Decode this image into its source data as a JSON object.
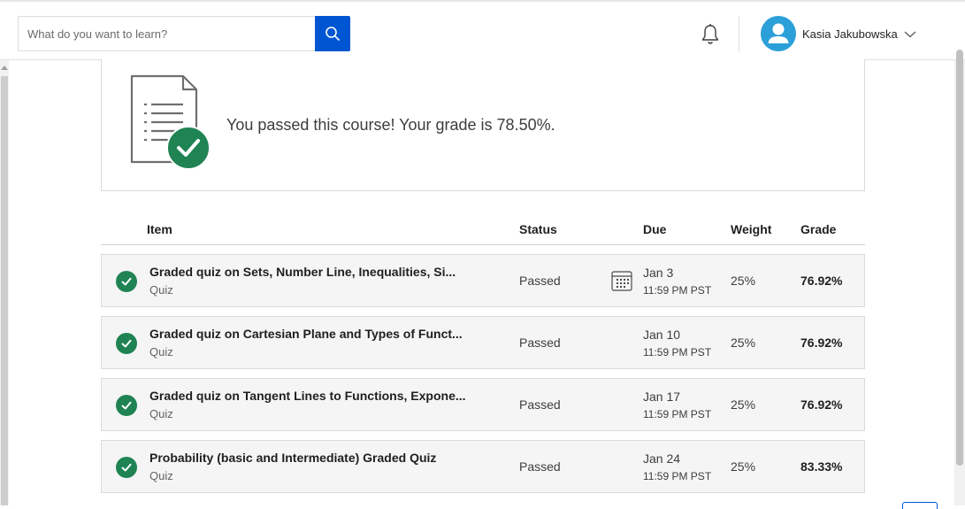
{
  "search": {
    "placeholder": "What do you want to learn?",
    "value": ""
  },
  "user": {
    "name": "Kasia Jakubowska"
  },
  "icons": {
    "search": "search-icon",
    "notifications": "bell-icon",
    "avatar": "person-icon",
    "menu": "chevron-down-icon",
    "passed": "checkmark-circle-icon",
    "due": "calendar-icon",
    "illustration": "document-checklist-icon"
  },
  "colors": {
    "brand_blue": "#0056d2",
    "passed_green": "#1f8354",
    "avatar_blue": "#2a9fd8"
  },
  "summary": {
    "message": "You passed this course! Your grade is 78.50%."
  },
  "table": {
    "headers": {
      "item": "Item",
      "status": "Status",
      "due": "Due",
      "weight": "Weight",
      "grade": "Grade"
    },
    "rows": [
      {
        "title": "Graded quiz on Sets, Number Line, Inequalities, Si...",
        "type": "Quiz",
        "status": "Passed",
        "due_date": "Jan 3",
        "due_time": "11:59 PM PST",
        "weight": "25%",
        "grade": "76.92%"
      },
      {
        "title": "Graded quiz on Cartesian Plane and Types of Funct...",
        "type": "Quiz",
        "status": "Passed",
        "due_date": "Jan 10",
        "due_time": "11:59 PM PST",
        "weight": "25%",
        "grade": "76.92%"
      },
      {
        "title": "Graded quiz on Tangent Lines to Functions, Expone...",
        "type": "Quiz",
        "status": "Passed",
        "due_date": "Jan 17",
        "due_time": "11:59 PM PST",
        "weight": "25%",
        "grade": "76.92%"
      },
      {
        "title": "Probability (basic and Intermediate) Graded Quiz",
        "type": "Quiz",
        "status": "Passed",
        "due_date": "Jan 24",
        "due_time": "11:59 PM PST",
        "weight": "25%",
        "grade": "83.33%"
      }
    ]
  }
}
